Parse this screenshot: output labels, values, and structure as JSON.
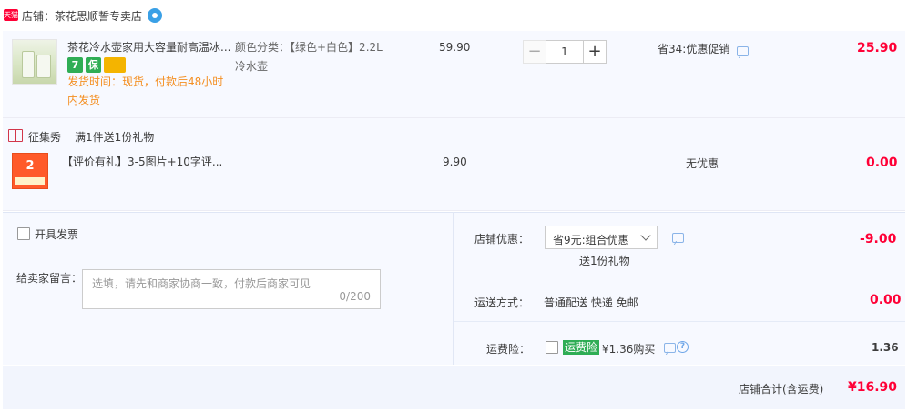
{
  "shop": {
    "badge": "天猫",
    "label": "店铺：茶花思顺誓专卖店"
  },
  "item1": {
    "title": "茶花冷水壶家用大容量耐高温冰...",
    "service_icons": [
      "7",
      "保",
      "卡"
    ],
    "ship_time": "发货时间：现货，付款后48小时内发货",
    "sku_line1": "颜色分类：【绿色+白色】2.2L",
    "sku_line2": "冷水壶",
    "unit_price": "59.90",
    "quantity": "1",
    "minus": "−",
    "plus": "+",
    "discount": "省34:优惠促销",
    "total": "25.90"
  },
  "promo": {
    "tag": "征集秀",
    "text": "满1件送1份礼物"
  },
  "item2": {
    "thumb_text": "2",
    "title": "【评价有礼】3-5图片+10字评...",
    "unit_price": "9.90",
    "discount": "无优惠",
    "total": "0.00"
  },
  "left_panel": {
    "invoice_label": "开具发票",
    "message_label": "给卖家留言：",
    "message_placeholder": "选填，请先和商家协商一致，付款后商家可见",
    "message_count": "0/200"
  },
  "right_panel": {
    "shop_discount_label": "店铺优惠：",
    "shop_discount_value": "省9元:组合优惠",
    "gift_note": "送1份礼物",
    "shop_discount_amount": "-9.00",
    "shipping_label": "运送方式：",
    "shipping_value": "普通配送 快递 免邮",
    "shipping_amount": "0.00",
    "insurance_label": "运费险：",
    "insurance_tag": "运费险",
    "insurance_price": "¥1.36购买",
    "insurance_amount": "1.36"
  },
  "summary": {
    "label": "店铺合计(含运费)",
    "amount": "¥16.90"
  },
  "colors": {
    "accent_red": "#ff0036",
    "orange": "#f49024",
    "green": "#2fad55",
    "link_blue": "#8ab4e8"
  }
}
